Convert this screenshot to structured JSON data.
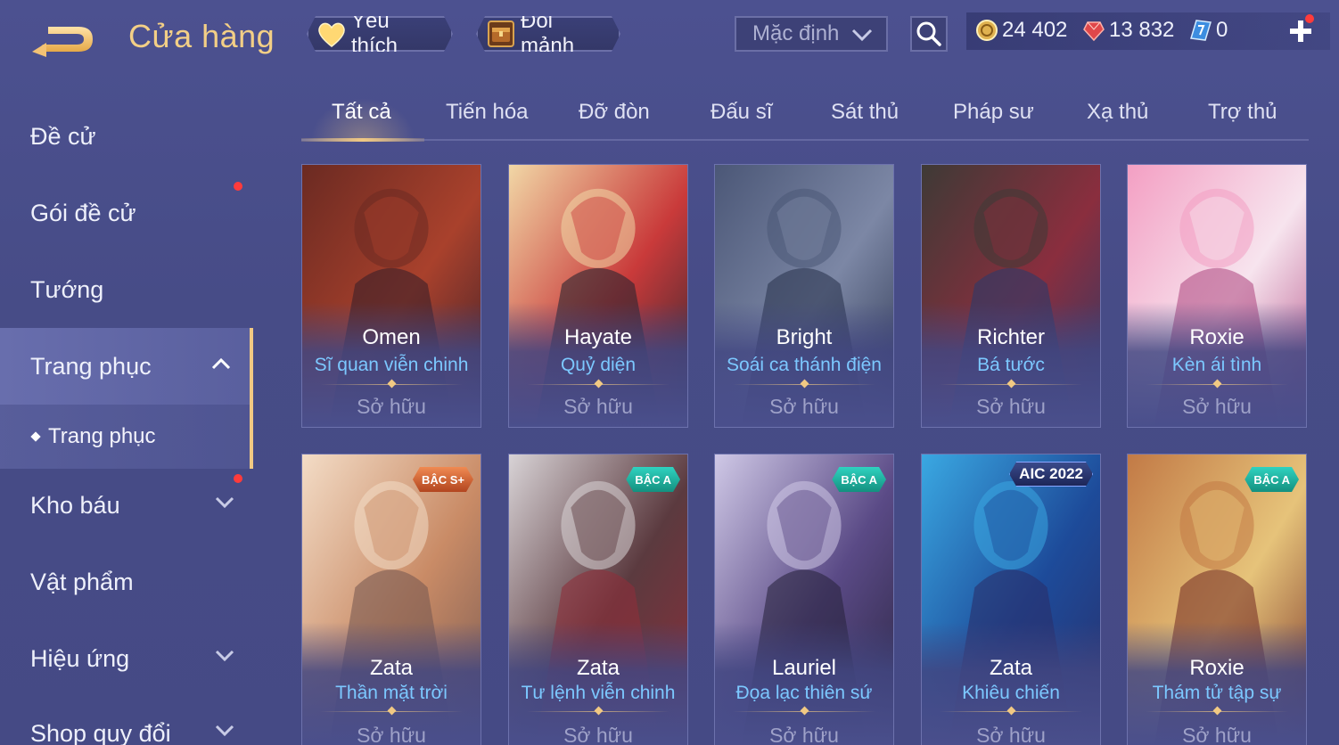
{
  "header": {
    "title": "Cửa hàng",
    "favorites_label": "Yêu thích",
    "exchange_label": "Đổi mảnh",
    "sort_value": "Mặc định"
  },
  "currency": {
    "gold": "24 402",
    "ruby": "13 832",
    "voucher": "0"
  },
  "sidebar": {
    "items": [
      {
        "label": "Đề cử"
      },
      {
        "label": "Gói đề cử"
      },
      {
        "label": "Tướng"
      },
      {
        "label": "Trang phục"
      },
      {
        "label": "Kho báu"
      },
      {
        "label": "Vật phẩm"
      },
      {
        "label": "Hiệu ứng"
      },
      {
        "label": "Shop quy đổi"
      }
    ],
    "subitem": "Trang phục"
  },
  "tabs": [
    {
      "label": "Tất cả"
    },
    {
      "label": "Tiến hóa"
    },
    {
      "label": "Đỡ đòn"
    },
    {
      "label": "Đấu sĩ"
    },
    {
      "label": "Sát thủ"
    },
    {
      "label": "Pháp sư"
    },
    {
      "label": "Xạ thủ"
    },
    {
      "label": "Trợ thủ"
    }
  ],
  "cards": [
    {
      "hero": "Omen",
      "skin": "Sĩ quan viễn chinh",
      "status": "Sở hữu",
      "badge": "",
      "palette": [
        "#6b2a22",
        "#a9412c",
        "#3a1f2a"
      ]
    },
    {
      "hero": "Hayate",
      "skin": "Quỷ diện",
      "status": "Sở hữu",
      "badge": "",
      "palette": [
        "#f1d7a6",
        "#c93a3a",
        "#2a2530"
      ]
    },
    {
      "hero": "Bright",
      "skin": "Soái ca thánh điện",
      "status": "Sở hữu",
      "badge": "",
      "palette": [
        "#4b5777",
        "#7c87a5",
        "#2c3550"
      ]
    },
    {
      "hero": "Richter",
      "skin": "Bá tước",
      "status": "Sở hữu",
      "badge": "",
      "palette": [
        "#3e3a36",
        "#8a2e3e",
        "#2c3a6a"
      ]
    },
    {
      "hero": "Roxie",
      "skin": "Kèn ái tình",
      "status": "Sở hữu",
      "badge": "",
      "palette": [
        "#f39fc3",
        "#f7e4ee",
        "#b24e85"
      ]
    },
    {
      "hero": "Zata",
      "skin": "Thần mặt trời",
      "status": "Sở hữu",
      "badge": "BẬC S+",
      "palette": [
        "#f3dcc6",
        "#c98b66",
        "#7a5a52"
      ]
    },
    {
      "hero": "Zata",
      "skin": "Tư lệnh viễn chinh",
      "status": "Sở hữu",
      "badge": "BẬC A",
      "palette": [
        "#d8d3d6",
        "#5b3a3f",
        "#8d2e3a"
      ]
    },
    {
      "hero": "Lauriel",
      "skin": "Đọa lạc thiên sứ",
      "status": "Sở hữu",
      "badge": "BẬC A",
      "palette": [
        "#cfc8e6",
        "#5a4a86",
        "#2a2440"
      ]
    },
    {
      "hero": "Zata",
      "skin": "Khiêu chiến",
      "status": "Sở hữu",
      "badge": "AIC 2022",
      "palette": [
        "#3aa8e2",
        "#1d4b9a",
        "#2a2f6a"
      ]
    },
    {
      "hero": "Roxie",
      "skin": "Thám tử tập sự",
      "status": "Sở hữu",
      "badge": "BẬC A",
      "palette": [
        "#c27a46",
        "#e6c37a",
        "#7a3428"
      ]
    }
  ]
}
